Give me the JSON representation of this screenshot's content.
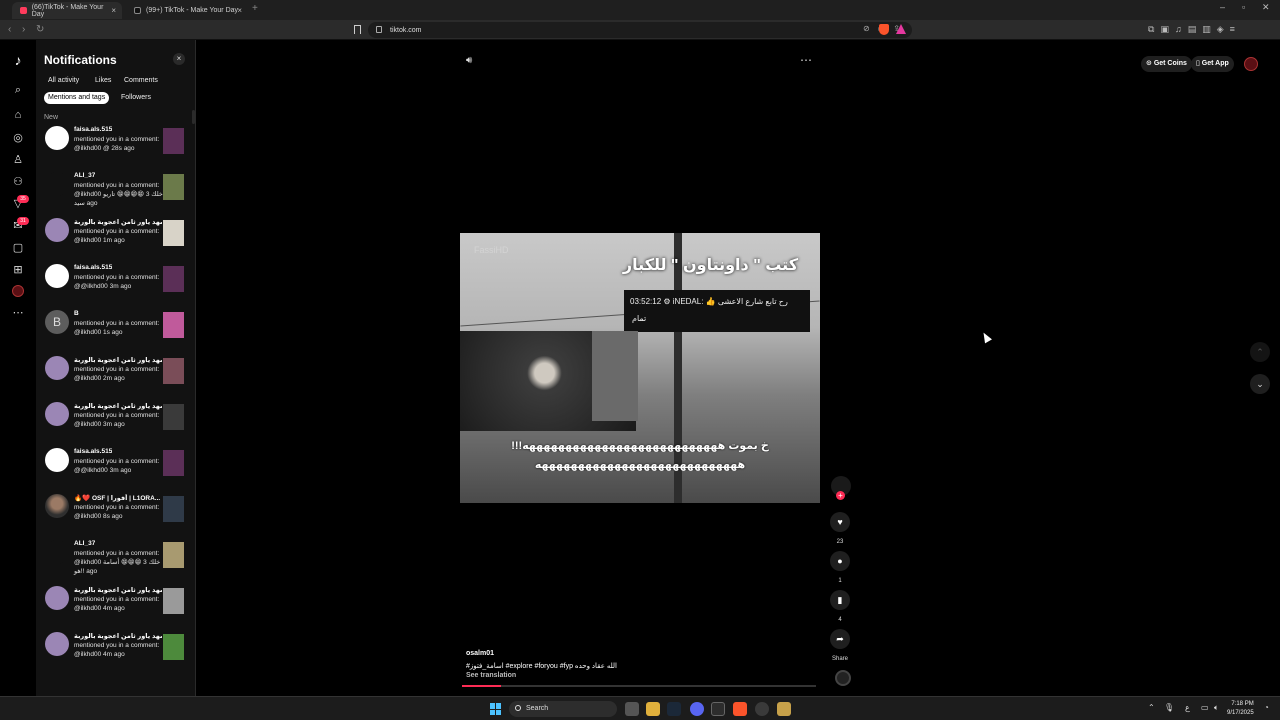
{
  "browser": {
    "tabs": [
      {
        "title": "(66)TikTok - Make Your Day",
        "close": "×"
      },
      {
        "title": "(99+) TikTok - Make Your Day",
        "close": "×"
      }
    ],
    "new_tab": "+",
    "url": "tiktok.com"
  },
  "notifications": {
    "title": "Notifications",
    "close": "×",
    "filters_row1": [
      "All activity",
      "Likes",
      "Comments"
    ],
    "filters_row2": [
      "Mentions and tags",
      "Followers"
    ],
    "section_label": "New",
    "items": [
      {
        "user": "faisa.als.515",
        "text": "mentioned you in a comment: @ilkhd00 @ 28s ago",
        "avatar": "white",
        "thumb": "#5b2f57"
      },
      {
        "user": "ALI_37",
        "text": "mentioned you in a comment: @ilkhd00 خلك 3 😁😁😁😁 تاريو سيد ago",
        "avatar": "dark",
        "thumb": "#6b7a4a"
      },
      {
        "user": "شهد ياور ثامن اعجوبة بالوربة",
        "text": "mentioned you in a comment: @ilkhd00 1m ago",
        "avatar": "purple",
        "thumb": "#d8d3c8"
      },
      {
        "user": "faisa.als.515",
        "text": "mentioned you in a comment: @@ilkhd00 3m ago",
        "avatar": "white",
        "thumb": "#5b2f57"
      },
      {
        "user": "B",
        "text": "mentioned you in a comment: @ilkhd00 1s ago",
        "avatar": "gray",
        "avatar_letter": "B",
        "thumb": "#c05a9b"
      },
      {
        "user": "شهد ياور ثامن اعجوبة بالوربة",
        "text": "mentioned you in a comment: @ilkhd00 2m ago",
        "avatar": "purple",
        "thumb": "#7a4d58"
      },
      {
        "user": "شهد ياور ثامن اعجوبة بالوربة",
        "text": "mentioned you in a comment: @ilkhd00 3m ago",
        "avatar": "purple",
        "thumb": "#3a3a3a"
      },
      {
        "user": "faisa.als.515",
        "text": "mentioned you in a comment: @@ilkhd00 3m ago",
        "avatar": "white",
        "thumb": "#5b2f57"
      },
      {
        "user": "🔥❤️ OSF | أفورا | L1ORA...",
        "text": "mentioned you in a comment: @ilkhd00 8s ago",
        "avatar": "photo",
        "thumb": "#2f3a48"
      },
      {
        "user": "ALI_37",
        "text": "mentioned you in a comment: @ilkhd00 خلك 3 😁😁😁 أسامة هو!! ago",
        "avatar": "dark",
        "thumb": "#a89a70"
      },
      {
        "user": "شهد ياور ثامن اعجوبة بالوربة",
        "text": "mentioned you in a comment: @ilkhd00 4m ago",
        "avatar": "purple",
        "thumb": "#9a9a9a"
      },
      {
        "user": "شهد ياور ثامن اعجوبة بالوربة",
        "text": "mentioned you in a comment: @ilkhd00 4m ago",
        "avatar": "purple",
        "thumb": "#4d8a3c"
      }
    ]
  },
  "rail": {
    "badge_inbox": "35",
    "badge_activity": "31"
  },
  "top_right": {
    "get_coins": "Get Coins",
    "get_app": "Get App"
  },
  "video": {
    "watermark": "FassiHD",
    "overlay_title": "كتب \" داونتاون \" للكبار",
    "chat_line": "03:52:12 ⚙ iNEDAL: 👍 رح تابع شارع الاعشى",
    "chat_reply": "تمام",
    "subtitle1": "!!!خ بموت هههههههههههههههههههههههههههه",
    "subtitle2": "ههههههههههههههههههههههههههههه"
  },
  "actions": {
    "likes": "23",
    "comments": "1",
    "saves": "4",
    "share": "Share"
  },
  "caption": {
    "user": "osalm01",
    "text": "#اسامة_فتوز #explore #foryou #fyp الله عقاد وحده",
    "see_translation": "See translation",
    "progress": 0.11
  },
  "taskbar": {
    "search": "Search",
    "lang": "ع",
    "time": "7:18 PM",
    "date": "9/17/2025"
  },
  "colors": {
    "accent": "#fe2c55",
    "panel": "#121212"
  }
}
